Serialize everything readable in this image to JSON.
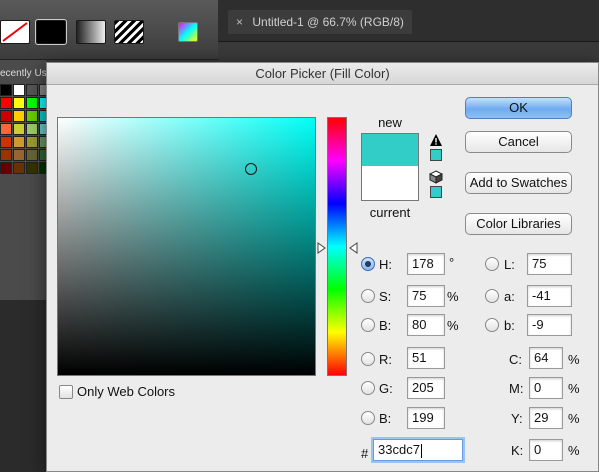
{
  "background": {
    "document_tab": {
      "close": "×",
      "title": "Untitled-1 @ 66.7% (RGB/8)"
    },
    "recently_used_label": "ecently Use",
    "mini_swatch_colors": [
      "#000000",
      "#ffffff",
      "#555555",
      "#888888",
      "#ff0000",
      "#ffff00",
      "#00ff00",
      "#00ffff",
      "#cc0000",
      "#ffcc00",
      "#66cc00",
      "#00cccc",
      "#ff6633",
      "#cccc33",
      "#99cc66",
      "#66cccc",
      "#cc3300",
      "#cc9933",
      "#999933",
      "#669966",
      "#993300",
      "#996633",
      "#666633",
      "#336633",
      "#660000",
      "#663300",
      "#333300",
      "#003300"
    ]
  },
  "dialog": {
    "title": "Color Picker (Fill Color)",
    "new_label": "new",
    "current_label": "current",
    "new_color": "#33cdc7",
    "current_color": "#ffffff",
    "out_of_gamut_chip": "#33cdc7",
    "web_safe_chip": "#33cccc",
    "buttons": {
      "ok": "OK",
      "cancel": "Cancel",
      "add_to_swatches": "Add to Swatches",
      "color_libraries": "Color Libraries"
    },
    "only_web_colors": "Only Web Colors",
    "hsb": {
      "h_label": "H:",
      "h_value": "178",
      "h_unit": "°",
      "s_label": "S:",
      "s_value": "75",
      "s_unit": "%",
      "b_label": "B:",
      "b_value": "80",
      "b_unit": "%"
    },
    "rgb": {
      "r_label": "R:",
      "r_value": "51",
      "g_label": "G:",
      "g_value": "205",
      "b_label": "B:",
      "b_value": "199"
    },
    "lab": {
      "l_label": "L:",
      "l_value": "75",
      "a_label": "a:",
      "a_value": "-41",
      "b_label": "b:",
      "b_value": "-9"
    },
    "cmyk": {
      "c_label": "C:",
      "c_value": "64",
      "c_unit": "%",
      "m_label": "M:",
      "m_value": "0",
      "m_unit": "%",
      "y_label": "Y:",
      "y_value": "29",
      "y_unit": "%",
      "k_label": "K:",
      "k_value": "0",
      "k_unit": "%"
    },
    "hex": {
      "label": "#",
      "value": "33cdc7"
    },
    "selected_mode": "H",
    "picker": {
      "saturation_fraction": 0.75,
      "brightness_fraction": 0.8,
      "hue_degrees": 178
    }
  }
}
